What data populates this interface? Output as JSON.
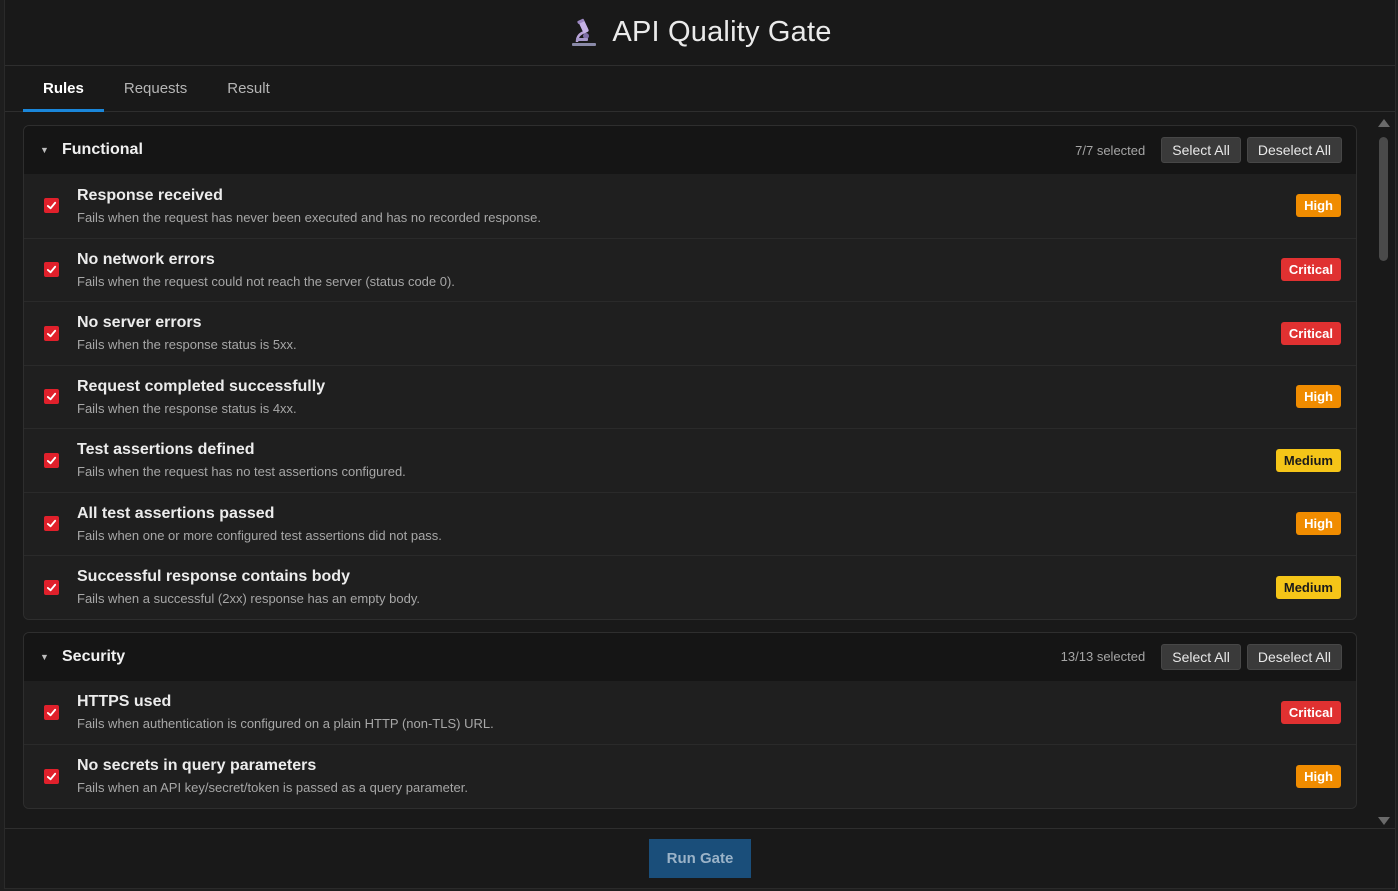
{
  "app": {
    "title": "API Quality Gate",
    "logo_icon": "microscope-icon"
  },
  "tabs": [
    {
      "label": "Rules",
      "active": true
    },
    {
      "label": "Requests",
      "active": false
    },
    {
      "label": "Result",
      "active": false
    }
  ],
  "sections": [
    {
      "title": "Functional",
      "count_text": "7/7 selected",
      "select_all_label": "Select All",
      "deselect_all_label": "Deselect All",
      "rules": [
        {
          "title": "Response received",
          "desc": "Fails when the request has never been executed and has no recorded response.",
          "severity": "High",
          "checked": true
        },
        {
          "title": "No network errors",
          "desc": "Fails when the request could not reach the server (status code 0).",
          "severity": "Critical",
          "checked": true
        },
        {
          "title": "No server errors",
          "desc": "Fails when the response status is 5xx.",
          "severity": "Critical",
          "checked": true
        },
        {
          "title": "Request completed successfully",
          "desc": "Fails when the response status is 4xx.",
          "severity": "High",
          "checked": true
        },
        {
          "title": "Test assertions defined",
          "desc": "Fails when the request has no test assertions configured.",
          "severity": "Medium",
          "checked": true
        },
        {
          "title": "All test assertions passed",
          "desc": "Fails when one or more configured test assertions did not pass.",
          "severity": "High",
          "checked": true
        },
        {
          "title": "Successful response contains body",
          "desc": "Fails when a successful (2xx) response has an empty body.",
          "severity": "Medium",
          "checked": true
        }
      ]
    },
    {
      "title": "Security",
      "count_text": "13/13 selected",
      "select_all_label": "Select All",
      "deselect_all_label": "Deselect All",
      "rules": [
        {
          "title": "HTTPS used",
          "desc": "Fails when authentication is configured on a plain HTTP (non-TLS) URL.",
          "severity": "Critical",
          "checked": true
        },
        {
          "title": "No secrets in query parameters",
          "desc": "Fails when an API key/secret/token is passed as a query parameter.",
          "severity": "High",
          "checked": true
        }
      ]
    }
  ],
  "footer": {
    "run_label": "Run Gate"
  },
  "colors": {
    "accent": "#1a86d9",
    "checkbox": "#e0202b",
    "high": "#f08c00",
    "critical": "#e03131",
    "medium": "#f5c518"
  }
}
